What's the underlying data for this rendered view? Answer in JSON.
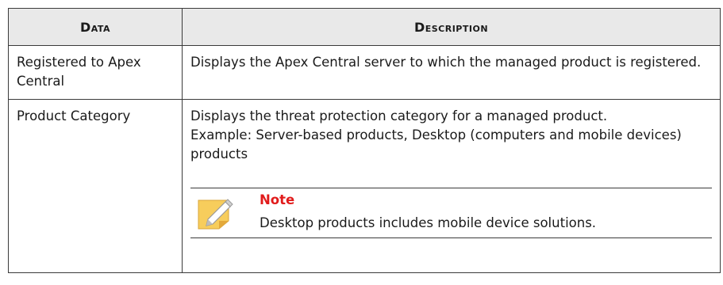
{
  "table": {
    "headers": {
      "data": "Data",
      "description": "Description"
    },
    "rows": [
      {
        "data": "Registered to Apex Central",
        "description": "Displays the Apex Central server to which the managed product is registered."
      },
      {
        "data": "Product Category",
        "description_line1": "Displays the threat protection category for a managed product.",
        "description_line2": "Example: Server-based products, Desktop (computers and mobile devices) products",
        "note": {
          "icon": "note-pencil-icon",
          "title": "Note",
          "text": "Desktop products includes mobile device solutions."
        }
      }
    ]
  },
  "colors": {
    "note_title": "#e11b1b",
    "header_bg": "#e9e9e9",
    "border": "#3a3a3a",
    "note_icon_fill": "#f7cd5c"
  }
}
